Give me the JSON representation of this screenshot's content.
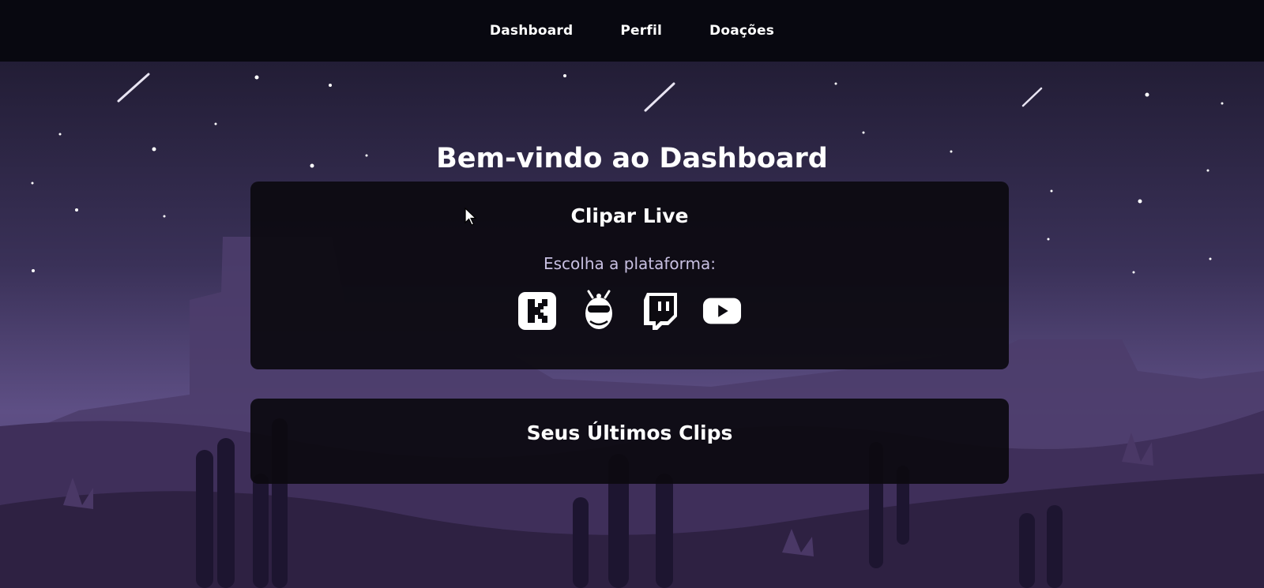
{
  "nav": {
    "items": [
      {
        "label": "Dashboard"
      },
      {
        "label": "Perfil"
      },
      {
        "label": "Doações"
      }
    ]
  },
  "title": "Bem-vindo ao Dashboard",
  "clip_card": {
    "title": "Clipar Live",
    "subtitle": "Escolha a plataforma:",
    "platforms": [
      {
        "icon": "kick-icon"
      },
      {
        "icon": "mascot-icon"
      },
      {
        "icon": "twitch-icon"
      },
      {
        "icon": "youtube-icon"
      }
    ]
  },
  "clips_card": {
    "title": "Seus Últimos Clips"
  },
  "colors": {
    "nav_bg": "#080810",
    "card_bg": "#0c0a10",
    "sky_top": "#1d1830",
    "sky_bottom": "#5b4c80",
    "hill_dark": "#3a2b50",
    "text": "#ffffff",
    "subtitle": "#c8c0e2"
  }
}
